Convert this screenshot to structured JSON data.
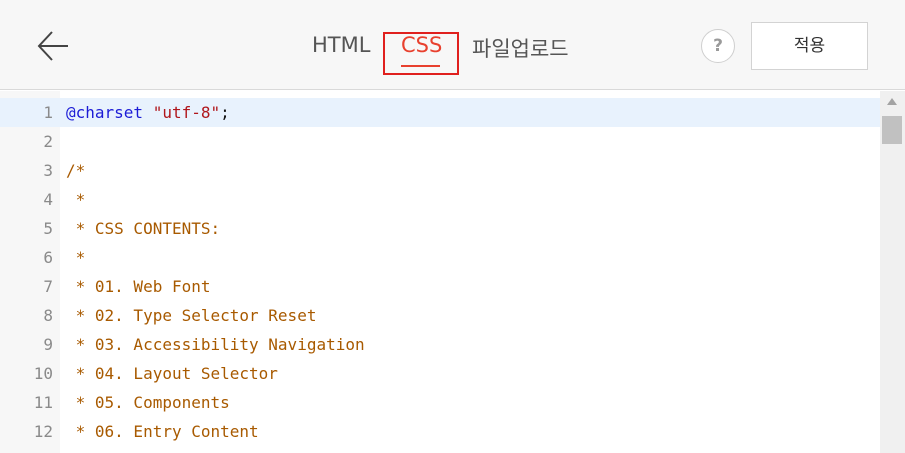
{
  "header": {
    "back_icon": "arrow-left-icon",
    "tabs": {
      "html": "HTML",
      "css": "CSS",
      "upload": "파일업로드"
    },
    "active_tab": "CSS",
    "help_label": "?",
    "apply_label": "적용",
    "accent_color": "#e8402e"
  },
  "editor": {
    "lines": [
      {
        "num": "1",
        "parts": [
          {
            "t": "@charset",
            "c": "keyword"
          },
          {
            "t": " ",
            "c": "plain"
          },
          {
            "t": "\"utf-8\"",
            "c": "string"
          },
          {
            "t": ";",
            "c": "plain"
          }
        ]
      },
      {
        "num": "2",
        "parts": []
      },
      {
        "num": "3",
        "parts": [
          {
            "t": "/*",
            "c": "comment"
          }
        ]
      },
      {
        "num": "4",
        "parts": [
          {
            "t": " *",
            "c": "comment"
          }
        ]
      },
      {
        "num": "5",
        "parts": [
          {
            "t": " * CSS CONTENTS:",
            "c": "comment"
          }
        ]
      },
      {
        "num": "6",
        "parts": [
          {
            "t": " *",
            "c": "comment"
          }
        ]
      },
      {
        "num": "7",
        "parts": [
          {
            "t": " * 01. Web Font",
            "c": "comment"
          }
        ]
      },
      {
        "num": "8",
        "parts": [
          {
            "t": " * 02. Type Selector Reset",
            "c": "comment"
          }
        ]
      },
      {
        "num": "9",
        "parts": [
          {
            "t": " * 03. Accessibility Navigation",
            "c": "comment"
          }
        ]
      },
      {
        "num": "10",
        "parts": [
          {
            "t": " * 04. Layout Selector",
            "c": "comment"
          }
        ]
      },
      {
        "num": "11",
        "parts": [
          {
            "t": " * 05. Components",
            "c": "comment"
          }
        ]
      },
      {
        "num": "12",
        "parts": [
          {
            "t": " * 06. Entry Content",
            "c": "comment"
          }
        ]
      }
    ],
    "active_line": "1"
  }
}
